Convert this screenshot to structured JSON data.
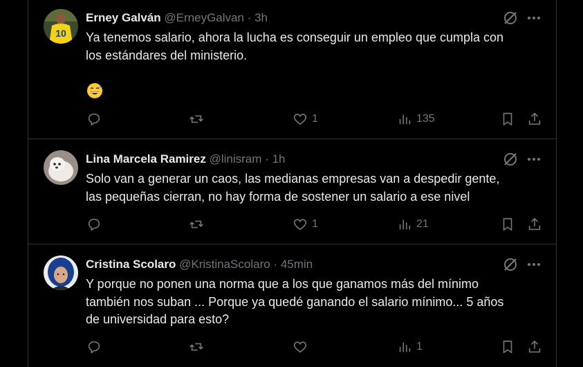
{
  "tweets": [
    {
      "name": "Erney Galván",
      "handle": "@ErneyGalvan",
      "sep": "·",
      "time": "3h",
      "text_lines": [
        "Ya tenemos salario, ahora la lucha es conseguir un empleo que cumpla con",
        "los estándares del ministerio."
      ],
      "emoji": "grinning-sweat-emoji",
      "avatar": "yellow-jersey-10",
      "likes": "1",
      "views": "135"
    },
    {
      "name": "Lina Marcela Ramirez",
      "handle": "@linisram",
      "sep": "·",
      "time": "1h",
      "text_lines": [
        "Solo van a generar un caos, las medianas empresas van a despedir gente,",
        "las pequeñas cierran, no hay forma de sostener un salario a ese nivel"
      ],
      "avatar": "white-dog",
      "likes": "1",
      "views": "21"
    },
    {
      "name": "Cristina Scolaro",
      "handle": "@KristinaScolaro",
      "sep": "·",
      "time": "45min",
      "text_lines": [
        "Y porque no ponen una norma que a los que ganamos más del mínimo",
        "también nos suban ... Porque ya quedé ganando el salario mínimo... 5 años",
        "de universidad para esto?"
      ],
      "avatar": "woman-blue-hair",
      "likes": "",
      "views": "1"
    }
  ],
  "icons": {
    "reply": "reply-icon",
    "retweet": "retweet-icon",
    "like": "heart-icon",
    "views": "views-icon",
    "bookmark": "bookmark-icon",
    "share": "share-icon",
    "grok": "grok-icon",
    "more": "more-icon"
  },
  "colors": {
    "background": "#000000",
    "text": "#e7e9ea",
    "muted": "#71767b",
    "border": "#2f3336"
  }
}
